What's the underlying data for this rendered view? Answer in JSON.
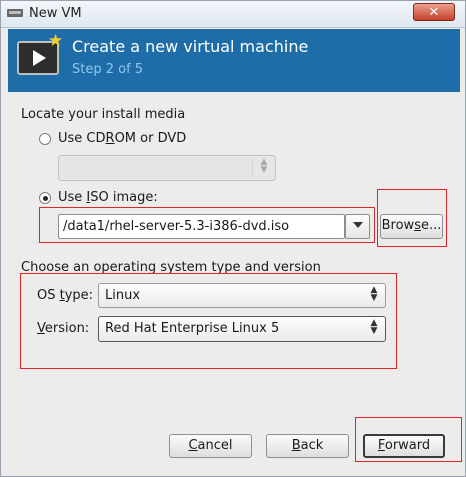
{
  "window": {
    "title": "New VM",
    "close_label": "✕"
  },
  "header": {
    "title": "Create a new virtual machine",
    "step": "Step 2 of 5"
  },
  "install_media": {
    "heading": "Locate your install media",
    "cdrom_option": {
      "pre": "Use CD",
      "key": "R",
      "post": "OM or DVD",
      "selected": false
    },
    "cdrom_select": {
      "value": "",
      "enabled": false
    },
    "iso_option": {
      "pre": "Use ",
      "key": "I",
      "post": "SO image:",
      "selected": true
    },
    "iso_path": "/data1/rhel-server-5.3-i386-dvd.iso",
    "browse_button": {
      "pre": "Brow",
      "key": "s",
      "post": "e..."
    }
  },
  "os_section": {
    "heading": "Choose an operating system type and version",
    "os_type_label": {
      "pre": "OS ",
      "key": "t",
      "post": "ype:"
    },
    "os_type_value": "Linux",
    "version_label": {
      "pre": "",
      "key": "V",
      "post": "ersion:"
    },
    "version_value": "Red Hat Enterprise Linux 5"
  },
  "buttons": {
    "cancel": {
      "pre": "",
      "key": "C",
      "post": "ancel"
    },
    "back": {
      "pre": "",
      "key": "B",
      "post": "ack"
    },
    "forward": {
      "pre": "",
      "key": "F",
      "post": "orward"
    }
  },
  "colors": {
    "header_bg": "#1e6da8",
    "highlight": "#e0242d",
    "step_text": "#8ec6ef"
  }
}
